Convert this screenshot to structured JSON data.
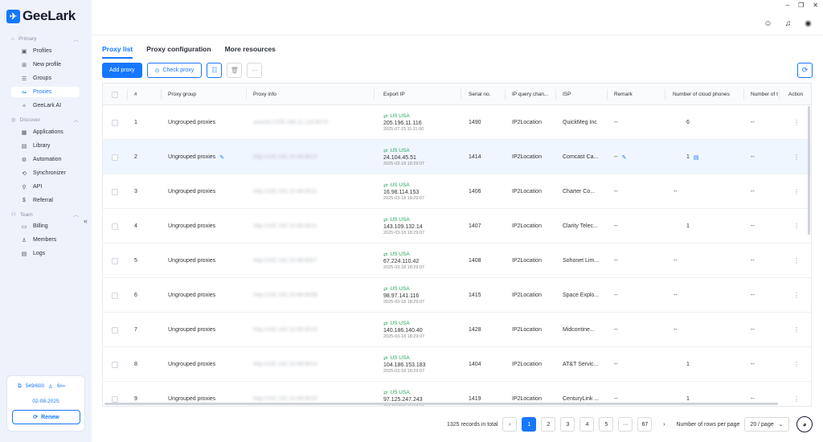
{
  "app": {
    "name": "GeeLark"
  },
  "window_controls": [
    "–",
    "❐",
    "✕"
  ],
  "sidebar": {
    "sections": [
      {
        "label": "Primary",
        "items": [
          {
            "label": "Profiles",
            "icon": "profiles-icon"
          },
          {
            "label": "New profile",
            "icon": "new-profile-icon"
          },
          {
            "label": "Groups",
            "icon": "groups-icon"
          },
          {
            "label": "Proxies",
            "icon": "proxies-icon",
            "active": true
          },
          {
            "label": "GeeLark AI",
            "icon": "ai-icon"
          }
        ]
      },
      {
        "label": "Discover",
        "items": [
          {
            "label": "Applications",
            "icon": "applications-icon"
          },
          {
            "label": "Library",
            "icon": "library-icon"
          },
          {
            "label": "Automation",
            "icon": "automation-icon"
          },
          {
            "label": "Synchronizer",
            "icon": "synchronizer-icon"
          },
          {
            "label": "API",
            "icon": "api-icon"
          },
          {
            "label": "Referral",
            "icon": "referral-icon"
          }
        ]
      },
      {
        "label": "Team",
        "items": [
          {
            "label": "Billing",
            "icon": "billing-icon"
          },
          {
            "label": "Members",
            "icon": "members-icon"
          },
          {
            "label": "Logs",
            "icon": "logs-icon"
          }
        ]
      }
    ],
    "collapse_glyph": "«",
    "plan": {
      "profiles": "549/600",
      "members": "6/∞",
      "date": "02-08-2025",
      "renew_label": "Renew"
    }
  },
  "tabs": [
    {
      "label": "Proxy list",
      "active": true
    },
    {
      "label": "Proxy configuration"
    },
    {
      "label": "More resources"
    }
  ],
  "toolbar": {
    "add_label": "Add proxy",
    "check_label": "Check proxy",
    "more": "···"
  },
  "table": {
    "columns": [
      "#",
      "Proxy group",
      "Proxy info",
      "Export IP",
      "Serial no.",
      "IP query chan...",
      "ISP",
      "Remark",
      "Number of cloud phones",
      "Number of t",
      "Action"
    ],
    "rows": [
      {
        "num": "1",
        "group": "Ungrouped proxies",
        "info": "socks5://205.196.11.116:8070",
        "loc": "US USA",
        "ip": "205.196.11.116",
        "ts": "2025-07-15 11:11:00",
        "serial": "1490",
        "query": "IP2Location",
        "isp": "QuickMeg Inc",
        "remark": "--",
        "phones": "6",
        "t": "--"
      },
      {
        "num": "2",
        "group": "Ungrouped proxies",
        "info": "http://192.162.10.68:8010",
        "loc": "US USA",
        "ip": "24.104.45.51",
        "ts": "2025-03-18 18:29:07",
        "serial": "1414",
        "query": "IP2Location",
        "isp": "Comcast Ca...",
        "remark": "--",
        "phones": "1",
        "t": "--",
        "highlight": true
      },
      {
        "num": "3",
        "group": "Ungrouped proxies",
        "info": "http://192.162.10.68:8011",
        "loc": "US USA",
        "ip": "16.98.114.153",
        "ts": "2025-03-18 18:29:07",
        "serial": "1406",
        "query": "IP2Location",
        "isp": "Charter Co...",
        "remark": "--",
        "phones": "--",
        "t": "--"
      },
      {
        "num": "4",
        "group": "Ungrouped proxies",
        "info": "http://192.162.10.68:8012",
        "loc": "US USA",
        "ip": "143.109.132.14",
        "ts": "2025-03-18 18:29:07",
        "serial": "1407",
        "query": "IP2Location",
        "isp": "Clarity Telec...",
        "remark": "--",
        "phones": "1",
        "t": "--"
      },
      {
        "num": "5",
        "group": "Ungrouped proxies",
        "info": "http://192.162.10.68:8007",
        "loc": "US USA",
        "ip": "67.224.110.42",
        "ts": "2025-03-18 18:29:07",
        "serial": "1408",
        "query": "IP2Location",
        "isp": "Sohonet Lim...",
        "remark": "--",
        "phones": "--",
        "t": "--"
      },
      {
        "num": "6",
        "group": "Ungrouped proxies",
        "info": "http://192.162.10.68:8008",
        "loc": "US USA",
        "ip": "98.97.141.116",
        "ts": "2025-03-18 18:29:07",
        "serial": "1415",
        "query": "IP2Location",
        "isp": "Space Explo...",
        "remark": "--",
        "phones": "--",
        "t": "--"
      },
      {
        "num": "7",
        "group": "Ungrouped proxies",
        "info": "http://192.162.10.68:8013",
        "loc": "US USA",
        "ip": "140.186.140.40",
        "ts": "2025-03-18 18:29:07",
        "serial": "1428",
        "query": "IP2Location",
        "isp": "Midcontine...",
        "remark": "--",
        "phones": "--",
        "t": "--"
      },
      {
        "num": "8",
        "group": "Ungrouped proxies",
        "info": "http://192.162.10.68:8014",
        "loc": "US USA",
        "ip": "104.186.153.183",
        "ts": "2025-03-18 18:29:07",
        "serial": "1404",
        "query": "IP2Location",
        "isp": "AT&T Servic...",
        "remark": "--",
        "phones": "1",
        "t": "--"
      },
      {
        "num": "9",
        "group": "Ungrouped proxies",
        "info": "http://192.162.10.68:8015",
        "loc": "US USA",
        "ip": "97.125.247.243",
        "ts": "2025-03-18 18:29:07",
        "serial": "1419",
        "query": "IP2Location",
        "isp": "CenturyLink ...",
        "remark": "--",
        "phones": "1",
        "t": "--"
      }
    ]
  },
  "pagination": {
    "total_text": "1325 records in total",
    "pages": [
      "1",
      "2",
      "3",
      "4",
      "5",
      "···",
      "67"
    ],
    "current": "1",
    "rows_label": "Number of rows per page",
    "rows_value": "20 / page"
  },
  "colors": {
    "accent": "#1677ff",
    "success": "#21a35a",
    "sidebar_bg": "#eef3fb"
  }
}
